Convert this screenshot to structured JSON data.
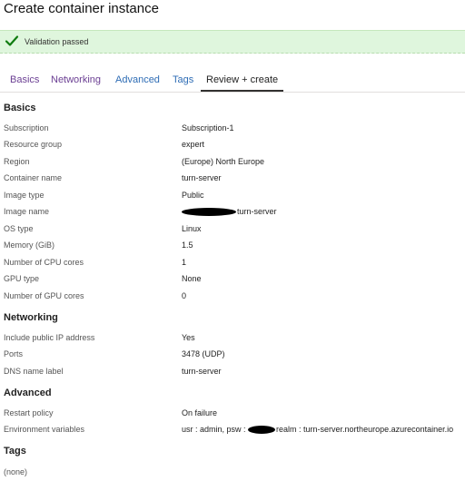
{
  "header": {
    "title": "Create container instance"
  },
  "banner": {
    "icon": "checkmark-icon",
    "message": "Validation passed",
    "color": "#dff6dd"
  },
  "tabs": [
    {
      "label": "Basics"
    },
    {
      "label": "Networking"
    },
    {
      "label": "Advanced"
    },
    {
      "label": "Tags"
    },
    {
      "label": "Review + create"
    }
  ],
  "basics": {
    "heading": "Basics",
    "rows": [
      {
        "label": "Subscription",
        "value": "Subscription-1"
      },
      {
        "label": "Resource group",
        "value": "expert"
      },
      {
        "label": "Region",
        "value": "(Europe) North Europe"
      },
      {
        "label": "Container name",
        "value": "turn-server"
      },
      {
        "label": "Image type",
        "value": "Public"
      },
      {
        "label": "Image name",
        "value": "turn-server"
      },
      {
        "label": "OS type",
        "value": "Linux"
      },
      {
        "label": "Memory (GiB)",
        "value": "1.5"
      },
      {
        "label": "Number of CPU cores",
        "value": "1"
      },
      {
        "label": "GPU type",
        "value": "None"
      },
      {
        "label": "Number of GPU cores",
        "value": "0"
      }
    ]
  },
  "networking": {
    "heading": "Networking",
    "rows": [
      {
        "label": "Include public IP address",
        "value": "Yes"
      },
      {
        "label": "Ports",
        "value": "3478 (UDP)"
      },
      {
        "label": "DNS name label",
        "value": "turn-server"
      }
    ]
  },
  "advanced": {
    "heading": "Advanced",
    "rows": [
      {
        "label": "Restart policy",
        "value": "On failure"
      },
      {
        "label": "Environment variables",
        "value_prefix": "usr : admin, psw : ",
        "value_suffix": "realm : turn-server.northeurope.azurecontainer.io"
      }
    ]
  },
  "tags": {
    "heading": "Tags",
    "value": "(none)"
  }
}
